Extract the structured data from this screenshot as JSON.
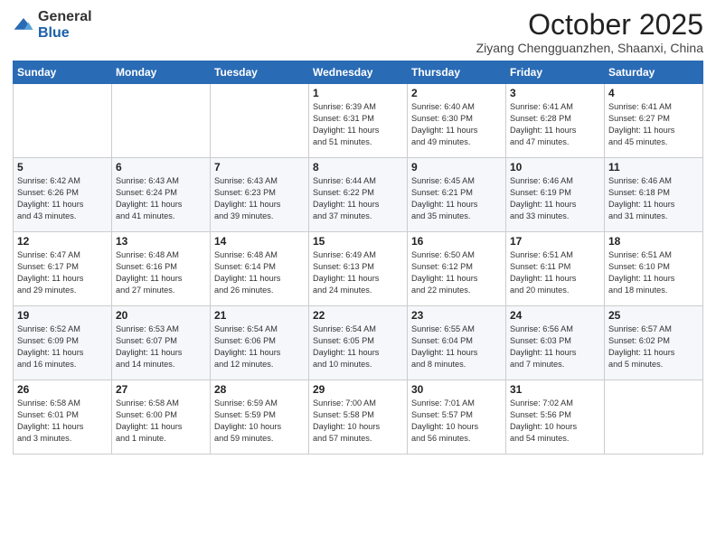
{
  "header": {
    "logo_general": "General",
    "logo_blue": "Blue",
    "month": "October 2025",
    "location": "Ziyang Chengguanzhen, Shaanxi, China"
  },
  "calendar": {
    "weekdays": [
      "Sunday",
      "Monday",
      "Tuesday",
      "Wednesday",
      "Thursday",
      "Friday",
      "Saturday"
    ],
    "weeks": [
      [
        {
          "day": "",
          "info": ""
        },
        {
          "day": "",
          "info": ""
        },
        {
          "day": "",
          "info": ""
        },
        {
          "day": "1",
          "info": "Sunrise: 6:39 AM\nSunset: 6:31 PM\nDaylight: 11 hours\nand 51 minutes."
        },
        {
          "day": "2",
          "info": "Sunrise: 6:40 AM\nSunset: 6:30 PM\nDaylight: 11 hours\nand 49 minutes."
        },
        {
          "day": "3",
          "info": "Sunrise: 6:41 AM\nSunset: 6:28 PM\nDaylight: 11 hours\nand 47 minutes."
        },
        {
          "day": "4",
          "info": "Sunrise: 6:41 AM\nSunset: 6:27 PM\nDaylight: 11 hours\nand 45 minutes."
        }
      ],
      [
        {
          "day": "5",
          "info": "Sunrise: 6:42 AM\nSunset: 6:26 PM\nDaylight: 11 hours\nand 43 minutes."
        },
        {
          "day": "6",
          "info": "Sunrise: 6:43 AM\nSunset: 6:24 PM\nDaylight: 11 hours\nand 41 minutes."
        },
        {
          "day": "7",
          "info": "Sunrise: 6:43 AM\nSunset: 6:23 PM\nDaylight: 11 hours\nand 39 minutes."
        },
        {
          "day": "8",
          "info": "Sunrise: 6:44 AM\nSunset: 6:22 PM\nDaylight: 11 hours\nand 37 minutes."
        },
        {
          "day": "9",
          "info": "Sunrise: 6:45 AM\nSunset: 6:21 PM\nDaylight: 11 hours\nand 35 minutes."
        },
        {
          "day": "10",
          "info": "Sunrise: 6:46 AM\nSunset: 6:19 PM\nDaylight: 11 hours\nand 33 minutes."
        },
        {
          "day": "11",
          "info": "Sunrise: 6:46 AM\nSunset: 6:18 PM\nDaylight: 11 hours\nand 31 minutes."
        }
      ],
      [
        {
          "day": "12",
          "info": "Sunrise: 6:47 AM\nSunset: 6:17 PM\nDaylight: 11 hours\nand 29 minutes."
        },
        {
          "day": "13",
          "info": "Sunrise: 6:48 AM\nSunset: 6:16 PM\nDaylight: 11 hours\nand 27 minutes."
        },
        {
          "day": "14",
          "info": "Sunrise: 6:48 AM\nSunset: 6:14 PM\nDaylight: 11 hours\nand 26 minutes."
        },
        {
          "day": "15",
          "info": "Sunrise: 6:49 AM\nSunset: 6:13 PM\nDaylight: 11 hours\nand 24 minutes."
        },
        {
          "day": "16",
          "info": "Sunrise: 6:50 AM\nSunset: 6:12 PM\nDaylight: 11 hours\nand 22 minutes."
        },
        {
          "day": "17",
          "info": "Sunrise: 6:51 AM\nSunset: 6:11 PM\nDaylight: 11 hours\nand 20 minutes."
        },
        {
          "day": "18",
          "info": "Sunrise: 6:51 AM\nSunset: 6:10 PM\nDaylight: 11 hours\nand 18 minutes."
        }
      ],
      [
        {
          "day": "19",
          "info": "Sunrise: 6:52 AM\nSunset: 6:09 PM\nDaylight: 11 hours\nand 16 minutes."
        },
        {
          "day": "20",
          "info": "Sunrise: 6:53 AM\nSunset: 6:07 PM\nDaylight: 11 hours\nand 14 minutes."
        },
        {
          "day": "21",
          "info": "Sunrise: 6:54 AM\nSunset: 6:06 PM\nDaylight: 11 hours\nand 12 minutes."
        },
        {
          "day": "22",
          "info": "Sunrise: 6:54 AM\nSunset: 6:05 PM\nDaylight: 11 hours\nand 10 minutes."
        },
        {
          "day": "23",
          "info": "Sunrise: 6:55 AM\nSunset: 6:04 PM\nDaylight: 11 hours\nand 8 minutes."
        },
        {
          "day": "24",
          "info": "Sunrise: 6:56 AM\nSunset: 6:03 PM\nDaylight: 11 hours\nand 7 minutes."
        },
        {
          "day": "25",
          "info": "Sunrise: 6:57 AM\nSunset: 6:02 PM\nDaylight: 11 hours\nand 5 minutes."
        }
      ],
      [
        {
          "day": "26",
          "info": "Sunrise: 6:58 AM\nSunset: 6:01 PM\nDaylight: 11 hours\nand 3 minutes."
        },
        {
          "day": "27",
          "info": "Sunrise: 6:58 AM\nSunset: 6:00 PM\nDaylight: 11 hours\nand 1 minute."
        },
        {
          "day": "28",
          "info": "Sunrise: 6:59 AM\nSunset: 5:59 PM\nDaylight: 10 hours\nand 59 minutes."
        },
        {
          "day": "29",
          "info": "Sunrise: 7:00 AM\nSunset: 5:58 PM\nDaylight: 10 hours\nand 57 minutes."
        },
        {
          "day": "30",
          "info": "Sunrise: 7:01 AM\nSunset: 5:57 PM\nDaylight: 10 hours\nand 56 minutes."
        },
        {
          "day": "31",
          "info": "Sunrise: 7:02 AM\nSunset: 5:56 PM\nDaylight: 10 hours\nand 54 minutes."
        },
        {
          "day": "",
          "info": ""
        }
      ]
    ]
  }
}
